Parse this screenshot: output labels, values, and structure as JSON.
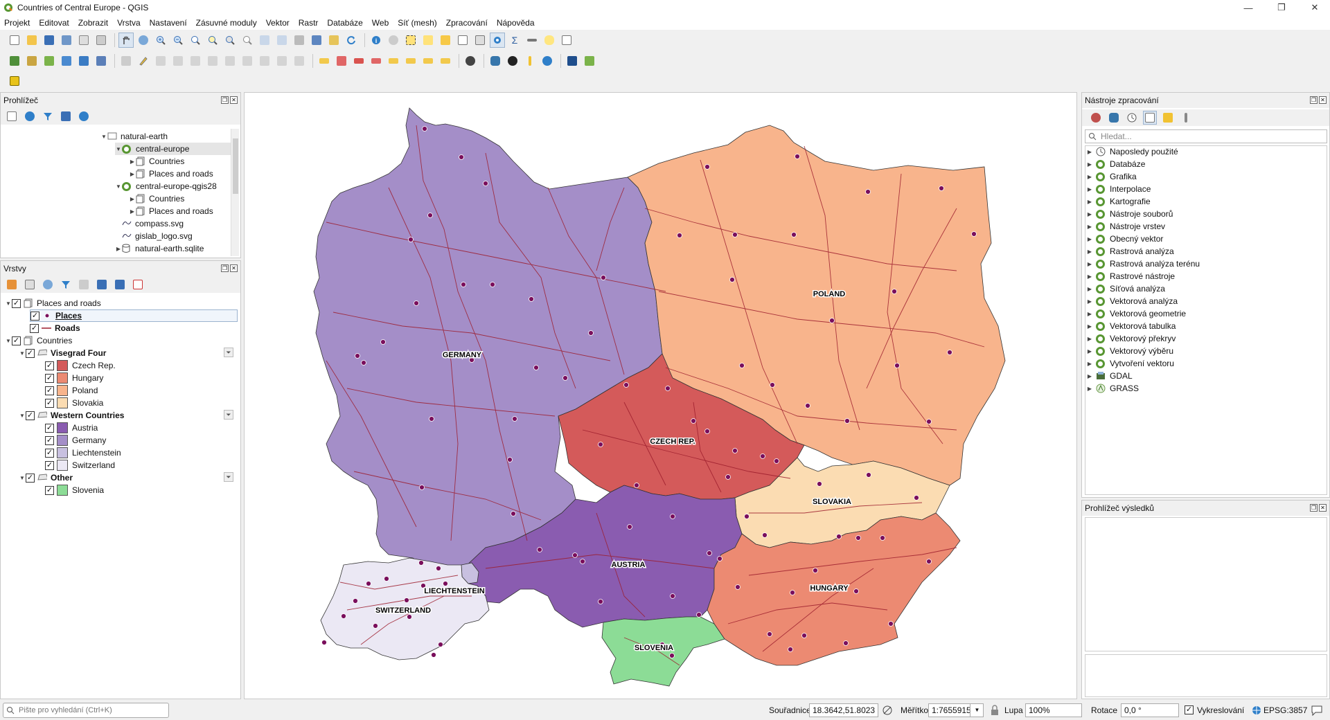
{
  "window": {
    "title": "Countries of Central Europe - QGIS",
    "minimize": "—",
    "maximize": "❐",
    "close": "✕"
  },
  "menu": [
    "Projekt",
    "Editovat",
    "Zobrazit",
    "Vrstva",
    "Nastavení",
    "Zásuvné moduly",
    "Vektor",
    "Rastr",
    "Databáze",
    "Web",
    "Síť (mesh)",
    "Zpracování",
    "Nápověda"
  ],
  "browser": {
    "title": "Prohlížeč",
    "items": [
      {
        "label": "natural-earth",
        "type": "folder",
        "level": 0,
        "expanded": true
      },
      {
        "label": "central-europe",
        "type": "qgis",
        "level": 1,
        "expanded": true
      },
      {
        "label": "Countries",
        "type": "group",
        "level": 2,
        "expanded": false
      },
      {
        "label": "Places and roads",
        "type": "group",
        "level": 2,
        "expanded": false
      },
      {
        "label": "central-europe-qgis28",
        "type": "qgis",
        "level": 1,
        "expanded": true
      },
      {
        "label": "Countries",
        "type": "group",
        "level": 2,
        "expanded": false
      },
      {
        "label": "Places and roads",
        "type": "group",
        "level": 2,
        "expanded": false
      },
      {
        "label": "compass.svg",
        "type": "svg",
        "level": 1
      },
      {
        "label": "gislab_logo.svg",
        "type": "svg",
        "level": 1
      },
      {
        "label": "natural-earth.sqlite",
        "type": "db",
        "level": 1,
        "expanded": false
      }
    ]
  },
  "layers": {
    "title": "Vrstvy",
    "groups": [
      {
        "label": "Places and roads",
        "bold": false,
        "items": [
          {
            "label": "Places",
            "symbol": "point",
            "color": "#7a0f5c",
            "bold": true,
            "underline": true
          },
          {
            "label": "Roads",
            "symbol": "line",
            "color": "#9c1c2c",
            "bold": true
          }
        ]
      },
      {
        "label": "Countries",
        "bold": false,
        "subgroups": [
          {
            "label": "Visegrad Four",
            "items": [
              {
                "label": "Czech Rep.",
                "color": "#d45a5a"
              },
              {
                "label": "Hungary",
                "color": "#ec8a72"
              },
              {
                "label": "Poland",
                "color": "#f8b48c"
              },
              {
                "label": "Slovakia",
                "color": "#fbdcb2"
              }
            ]
          },
          {
            "label": "Western Countries",
            "items": [
              {
                "label": "Austria",
                "color": "#8a5cb0"
              },
              {
                "label": "Germany",
                "color": "#a48ec8"
              },
              {
                "label": "Liechtenstein",
                "color": "#c8c0e0"
              },
              {
                "label": "Switzerland",
                "color": "#ebe8f4"
              }
            ]
          },
          {
            "label": "Other",
            "items": [
              {
                "label": "Slovenia",
                "color": "#8cdc96"
              }
            ]
          }
        ]
      }
    ]
  },
  "map": {
    "labels": [
      "GERMANY",
      "POLAND",
      "CZECH REP.",
      "SLOVAKIA",
      "AUSTRIA",
      "HUNGARY",
      "LIECHTENSTEIN",
      "SWITZERLAND",
      "SLOVENIA"
    ]
  },
  "processing": {
    "title": "Nástroje zpracování",
    "search_placeholder": "Hledat...",
    "items": [
      {
        "label": "Naposledy použité",
        "icon": "clock"
      },
      {
        "label": "Databáze",
        "icon": "qgis"
      },
      {
        "label": "Grafika",
        "icon": "qgis"
      },
      {
        "label": "Interpolace",
        "icon": "qgis"
      },
      {
        "label": "Kartografie",
        "icon": "qgis"
      },
      {
        "label": "Nástroje souborů",
        "icon": "qgis"
      },
      {
        "label": "Nástroje vrstev",
        "icon": "qgis"
      },
      {
        "label": "Obecný vektor",
        "icon": "qgis"
      },
      {
        "label": "Rastrová analýza",
        "icon": "qgis"
      },
      {
        "label": "Rastrová analýza terénu",
        "icon": "qgis"
      },
      {
        "label": "Rastrové nástroje",
        "icon": "qgis"
      },
      {
        "label": "Síťová analýza",
        "icon": "qgis"
      },
      {
        "label": "Vektorová analýza",
        "icon": "qgis"
      },
      {
        "label": "Vektorová geometrie",
        "icon": "qgis"
      },
      {
        "label": "Vektorová tabulka",
        "icon": "qgis"
      },
      {
        "label": "Vektorový překryv",
        "icon": "qgis"
      },
      {
        "label": "Vektorový výběru",
        "icon": "qgis"
      },
      {
        "label": "Vytvoření vektoru",
        "icon": "qgis"
      },
      {
        "label": "GDAL",
        "icon": "gdal"
      },
      {
        "label": "GRASS",
        "icon": "grass"
      }
    ]
  },
  "results": {
    "title": "Prohlížeč výsledků"
  },
  "status": {
    "search_placeholder": "Pište pro vyhledání (Ctrl+K)",
    "coord_label": "Souřadnice",
    "coord_value": "18.3642,51.8023",
    "scale_label": "Měřítko",
    "scale_value": "1:7655915",
    "magnifier_label": "Lupa",
    "magnifier_value": "100%",
    "rotation_label": "Rotace",
    "rotation_value": "0,0 °",
    "render_label": "Vykreslování",
    "crs": "EPSG:3857"
  }
}
